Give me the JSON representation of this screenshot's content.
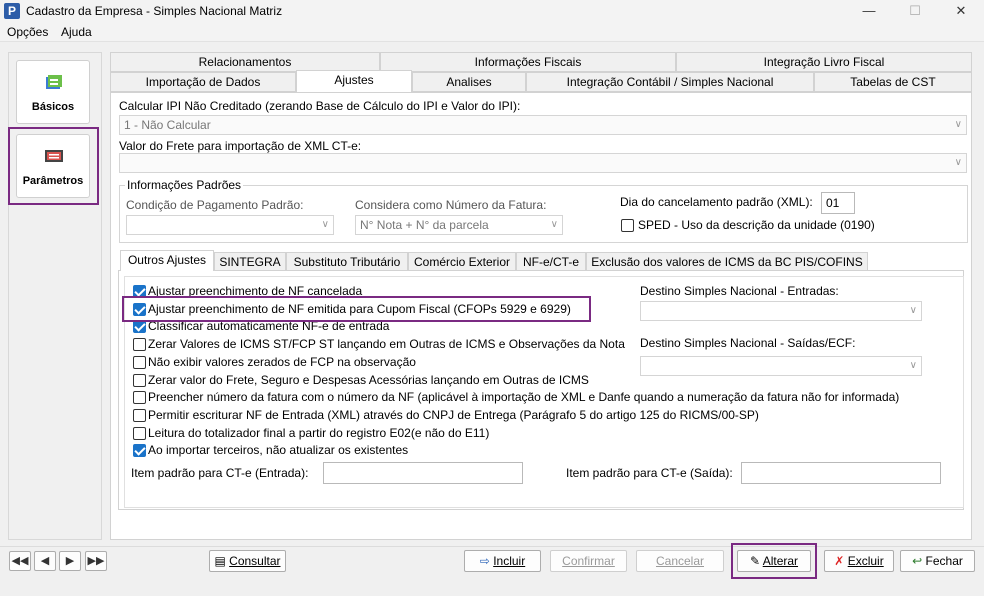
{
  "window": {
    "title": "Cadastro da Empresa - Simples Nacional Matriz",
    "app_icon_letter": "P",
    "minimize": "—",
    "maximize": "☐",
    "close": "✕"
  },
  "menu": [
    "Opções",
    "Ajuda"
  ],
  "sidebar": {
    "items": [
      {
        "label": "Básicos",
        "icon": "basicos-icon"
      },
      {
        "label": "Parâmetros",
        "icon": "parametros-icon"
      }
    ]
  },
  "tabs_row1": [
    "Relacionamentos",
    "Informações Fiscais",
    "Integração Livro Fiscal"
  ],
  "tabs_row2": [
    "Importação de Dados",
    "Ajustes",
    "Analises",
    "Integração Contábil / Simples Nacional",
    "Tabelas de CST"
  ],
  "fields": {
    "ipi_label": "Calcular IPI Não Creditado (zerando Base de Cálculo do IPI e Valor do IPI):",
    "ipi_value": "1 - Não Calcular",
    "frete_label": "Valor do Frete para importação de XML CT-e:",
    "frete_value": ""
  },
  "group_padroes": {
    "title": "Informações Padrões",
    "cond_label": "Condição de Pagamento Padrão:",
    "cond_value": "",
    "fatura_label": "Considera como Número da Fatura:",
    "fatura_value": "N° Nota + N° da parcela",
    "dia_label": "Dia do cancelamento padrão (XML):",
    "dia_value": "01",
    "sped_label": "SPED - Uso da descrição da unidade (0190)"
  },
  "subtabs": [
    "Outros Ajustes",
    "SINTEGRA",
    "Substituto Tributário",
    "Comércio Exterior",
    "NF-e/CT-e",
    "Exclusão dos valores de ICMS da BC PIS/COFINS"
  ],
  "checks": [
    {
      "label": "Ajustar preenchimento de NF cancelada",
      "checked": true
    },
    {
      "label": "Ajustar preenchimento de NF emitida para Cupom Fiscal (CFOPs 5929 e 6929)",
      "checked": true
    },
    {
      "label": "Classificar automaticamente NF-e de entrada",
      "checked": true
    },
    {
      "label": "Zerar Valores de ICMS ST/FCP ST lançando em Outras de ICMS e Observações da Nota",
      "checked": false
    },
    {
      "label": "Não exibir valores zerados de FCP na observação",
      "checked": false
    },
    {
      "label": "Zerar valor do Frete, Seguro e Despesas Acessórias lançando em Outras de ICMS",
      "checked": false
    },
    {
      "label": "Preencher número da fatura com o número da NF (aplicável à importação de XML e Danfe quando a numeração da fatura não for informada)",
      "checked": false
    },
    {
      "label": "Permitir escriturar NF de Entrada (XML) através do CNPJ de Entrega (Parágrafo 5 do artigo 125 do RICMS/00-SP)",
      "checked": false
    },
    {
      "label": "Leitura do totalizador final a partir do registro E02(e não do E11)",
      "checked": false
    },
    {
      "label": "Ao importar terceiros, não atualizar os existentes",
      "checked": true
    }
  ],
  "destino": {
    "entradas_label": "Destino Simples Nacional - Entradas:",
    "entradas_value": "",
    "saidas_label": "Destino Simples Nacional - Saídas/ECF:",
    "saidas_value": ""
  },
  "cte": {
    "entrada_label": "Item padrão para CT-e (Entrada):",
    "entrada_value": "",
    "saida_label": "Item padrão para CT-e (Saída):",
    "saida_value": ""
  },
  "buttons": {
    "consultar": "Consultar",
    "incluir": "Incluir",
    "confirmar": "Confirmar",
    "cancelar": "Cancelar",
    "alterar": "Alterar",
    "excluir": "Excluir",
    "fechar": "Fechar"
  },
  "colors": {
    "highlight": "#7a2a82",
    "checkbox": "#1a73c9"
  }
}
